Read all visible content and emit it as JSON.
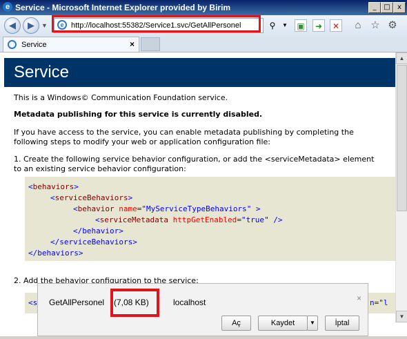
{
  "window": {
    "title": "Service - Microsoft Internet Explorer provided by Birim",
    "minimize": "_",
    "maximize": "□",
    "close": "x"
  },
  "navbar": {
    "back": "◀",
    "forward": "▶",
    "address": "http://localhost:55382/Service1.svc/GetAllPersonel",
    "search_glyph": "⚲",
    "compat": "▣",
    "go": "➜",
    "stop": "✕",
    "home": "⌂",
    "favorites": "☆",
    "tools": "⚙"
  },
  "tabs": [
    {
      "label": "Service",
      "close": "×"
    }
  ],
  "page": {
    "heading": "Service",
    "intro": "This is a Windows© Communication Foundation service.",
    "metadata_disabled": "Metadata publishing for this service is currently disabled.",
    "access_line1": "If you have access to the service, you can enable metadata publishing by completing the",
    "access_line2": "following steps to modify your web or application configuration file:",
    "step1_line1": "1. Create the following service behavior configuration, or add the <serviceMetadata> element",
    "step1_line2": "to an existing service behavior configuration:",
    "code": {
      "l1_open": "<",
      "l1_tag": "behaviors",
      "l1_close": ">",
      "l2_open": "<",
      "l2_tag": "serviceBehaviors",
      "l2_close": ">",
      "l3_open": "<",
      "l3_tag": "behavior",
      "l3_attr": " name",
      "l3_eq": "=\"",
      "l3_val": "MyServiceTypeBehaviors",
      "l3_end": "\" >",
      "l4_open": "<",
      "l4_tag": "serviceMetadata",
      "l4_attr": " httpGetEnabled",
      "l4_eq": "=\"",
      "l4_val": "true",
      "l4_end": "\" />",
      "l5": "</behavior>",
      "l6": "</serviceBehaviors>",
      "l7": "</behaviors>"
    },
    "step2": "2. Add the behavior configuration to the service:",
    "code2_start": "<s",
    "code2_end": "n=\"l"
  },
  "download": {
    "filename": "GetAllPersonel",
    "size": "(7,08 KB)",
    "source": "localhost",
    "open_label": "Aç",
    "save_label": "Kaydet",
    "save_dropdown": "▼",
    "cancel_label": "İptal",
    "close": "×"
  },
  "colors": {
    "heading_bg": "#003366",
    "code_bg": "#e6e6d3",
    "highlight": "#e0151a"
  }
}
